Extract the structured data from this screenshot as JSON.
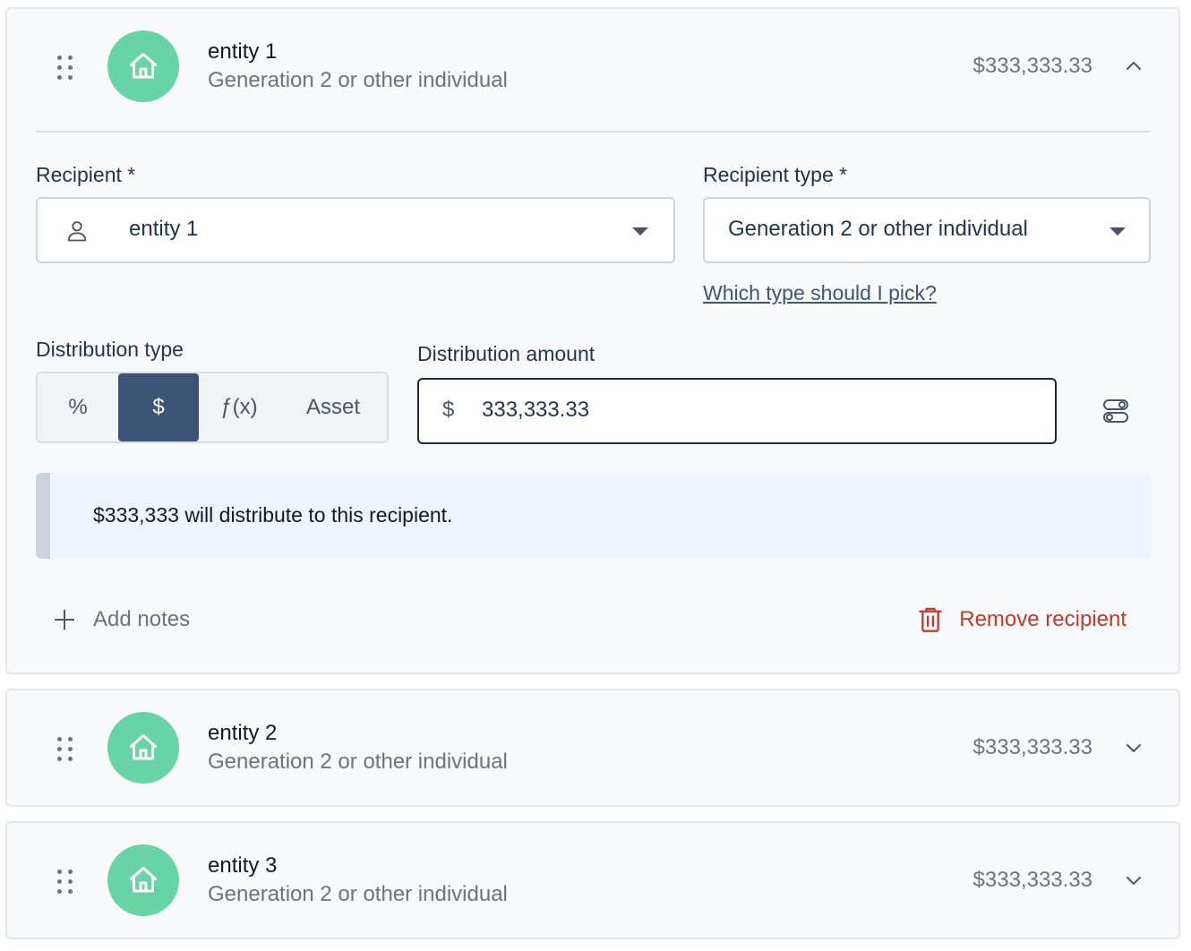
{
  "recipients": [
    {
      "name": "entity 1",
      "type": "Generation 2 or other individual",
      "amount": "$333,333.33",
      "expanded": true,
      "icon": "home-icon"
    },
    {
      "name": "entity 2",
      "type": "Generation 2 or other individual",
      "amount": "$333,333.33",
      "expanded": false,
      "icon": "home-icon"
    },
    {
      "name": "entity 3",
      "type": "Generation 2 or other individual",
      "amount": "$333,333.33",
      "expanded": false,
      "icon": "home-icon"
    }
  ],
  "form": {
    "recipient_label": "Recipient *",
    "recipient_value": "entity 1",
    "recipient_type_label": "Recipient type *",
    "recipient_type_value": "Generation 2 or other individual",
    "which_type_link": "Which type should I pick?",
    "distribution_type_label": "Distribution type",
    "distribution_types": [
      "%",
      "$",
      "ƒ(x)",
      "Asset"
    ],
    "distribution_type_selected": "$",
    "distribution_amount_label": "Distribution amount",
    "currency_symbol": "$",
    "distribution_amount_value": "333,333.33",
    "info_message": "$333,333 will distribute to this recipient.",
    "add_notes_label": "Add notes",
    "remove_recipient_label": "Remove recipient"
  },
  "colors": {
    "avatar": "#67d3a6",
    "active_segment": "#3c5475",
    "danger": "#c8372d",
    "info_bg": "#eff5fc"
  }
}
